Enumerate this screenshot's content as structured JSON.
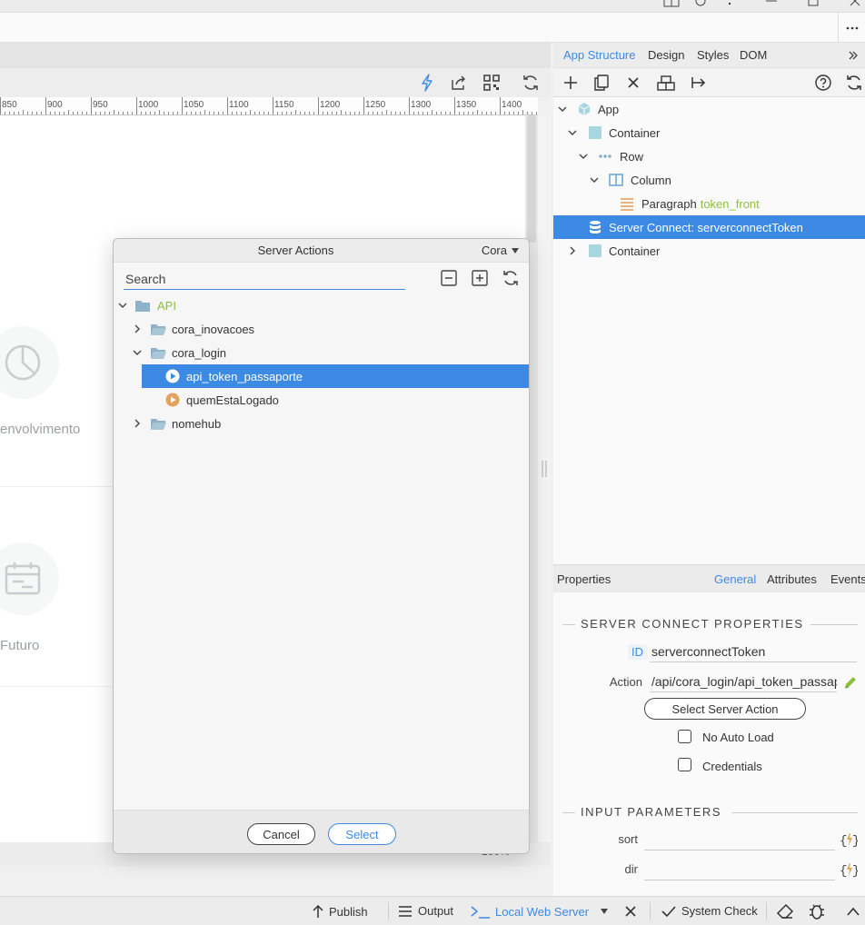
{
  "canvas": {
    "ruler_ticks": [
      "850",
      "900",
      "950",
      "1000",
      "1050",
      "1100",
      "1150",
      "1200",
      "1250",
      "1300",
      "1350",
      "1400"
    ],
    "cards": [
      {
        "label": "envolvimento",
        "icon": "pie-chart-icon"
      },
      {
        "label": "Futuro",
        "icon": "calendar-icon"
      }
    ],
    "zoom": "100%"
  },
  "right_panel": {
    "tabs": [
      {
        "label": "App Structure",
        "active": true
      },
      {
        "label": "Design",
        "active": false
      },
      {
        "label": "Styles",
        "active": false
      },
      {
        "label": "DOM",
        "active": false
      }
    ],
    "tree": [
      {
        "label": "App",
        "extra": "",
        "icon": "app-cube-icon",
        "expanded": true,
        "selected": false
      },
      {
        "label": "Container",
        "extra": "",
        "icon": "container-icon",
        "expanded": true,
        "selected": false
      },
      {
        "label": "Row",
        "extra": "",
        "icon": "row-dots-icon",
        "expanded": true,
        "selected": false
      },
      {
        "label": "Column",
        "extra": "",
        "icon": "column-icon",
        "expanded": true,
        "selected": false
      },
      {
        "label": "Paragraph",
        "extra": "token_front",
        "icon": "paragraph-icon",
        "expanded": null,
        "selected": false
      },
      {
        "label": "Server Connect: serverconnectToken",
        "extra": "",
        "icon": "database-icon",
        "expanded": null,
        "selected": true
      },
      {
        "label": "Container",
        "extra": "",
        "icon": "container-icon",
        "expanded": false,
        "selected": false
      }
    ],
    "properties": {
      "title": "Properties",
      "tabs": [
        {
          "label": "General",
          "active": true
        },
        {
          "label": "Attributes",
          "active": false
        },
        {
          "label": "Events",
          "active": false
        }
      ],
      "section_server": "SERVER CONNECT PROPERTIES",
      "id_label": "ID",
      "id_value": "serverconnectToken",
      "action_label": "Action",
      "action_value": "/api/cora_login/api_token_passaporte",
      "select_action_button": "Select Server Action",
      "no_auto_load": "No Auto Load",
      "credentials": "Credentials",
      "section_input": "INPUT PARAMETERS",
      "params": [
        {
          "label": "sort",
          "value": ""
        },
        {
          "label": "dir",
          "value": ""
        }
      ]
    }
  },
  "status_bar": {
    "publish": "Publish",
    "output": "Output",
    "local_server": "Local Web Server",
    "system_check": "System Check"
  },
  "dialog": {
    "title": "Server Actions",
    "target": "Cora",
    "search_placeholder": "Search",
    "tree": [
      {
        "label": "API",
        "kind": "root-folder",
        "expanded": true,
        "selected": false,
        "level": 0
      },
      {
        "label": "cora_inovacoes",
        "kind": "folder",
        "expanded": false,
        "selected": false,
        "level": 1
      },
      {
        "label": "cora_login",
        "kind": "folder",
        "expanded": true,
        "selected": false,
        "level": 1
      },
      {
        "label": "api_token_passaporte",
        "kind": "action",
        "expanded": null,
        "selected": true,
        "level": 2
      },
      {
        "label": "quemEstaLogado",
        "kind": "action",
        "expanded": null,
        "selected": false,
        "level": 2
      },
      {
        "label": "nomehub",
        "kind": "folder",
        "expanded": false,
        "selected": false,
        "level": 1
      }
    ],
    "cancel": "Cancel",
    "select": "Select"
  },
  "colors": {
    "accent": "#3d8ae4",
    "folder": "#8fb1c9",
    "action_orange": "#e5a35a",
    "api_green": "#8dbf3f"
  }
}
